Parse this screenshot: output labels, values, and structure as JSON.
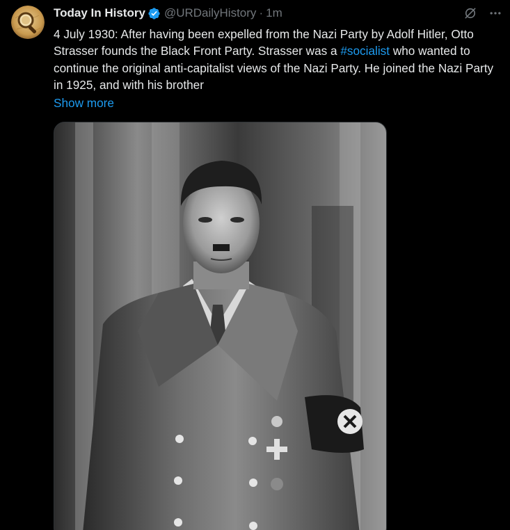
{
  "tweet": {
    "display_name": "Today In History",
    "handle": "@URDailyHistory",
    "separator": "·",
    "time": "1m",
    "text_part1": "4 July 1930: After having been expelled from the Nazi Party by Adolf Hitler, Otto Strasser founds the Black Front Party. Strasser was a ",
    "hashtag": "#socialist",
    "text_part2": " who wanted to continue the original anti-capitalist views of the Nazi Party. He joined the Nazi Party in 1925, and with his brother",
    "show_more": "Show more"
  },
  "icons": {
    "verified": "verified-badge-icon",
    "grok": "grok-icon",
    "more": "more-options-icon",
    "avatar": "magnifying-glass-avatar"
  },
  "colors": {
    "background": "#000000",
    "text": "#e7e9ea",
    "muted": "#71767b",
    "accent": "#1d9bf0"
  }
}
